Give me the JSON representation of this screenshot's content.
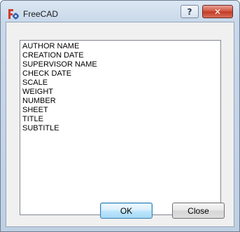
{
  "window": {
    "title": "FreeCAD",
    "help_glyph": "?",
    "close_glyph": "✕",
    "icons": {
      "app": "freecad-logo-icon",
      "help": "help-icon",
      "close": "close-icon"
    }
  },
  "list": {
    "items": [
      "AUTHOR NAME",
      "CREATION DATE",
      "SUPERVISOR NAME",
      "CHECK DATE",
      "SCALE",
      "WEIGHT",
      "NUMBER",
      "SHEET",
      "TITLE",
      "SUBTITLE"
    ]
  },
  "buttons": {
    "ok_label": "OK",
    "close_label": "Close"
  },
  "colors": {
    "titlebar": "#c9d9ea",
    "close_button": "#c23a22",
    "default_button_border": "#3c7fb1",
    "logo_red": "#d3392b",
    "logo_blue": "#2f5fb0"
  }
}
